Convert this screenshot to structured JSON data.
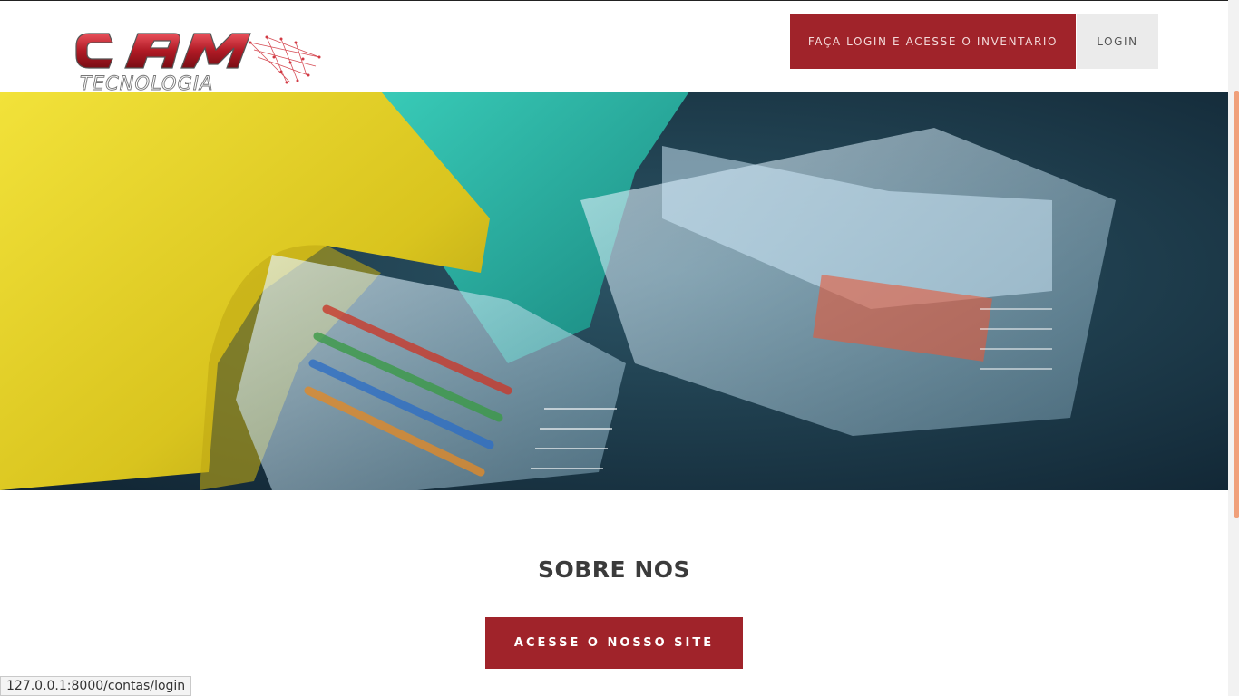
{
  "brand": {
    "logo_main": "CAM",
    "logo_sub": "TECNOLOGIA"
  },
  "nav": {
    "inventory_login_label": "FAÇA LOGIN E ACESSE O INVENTARIO",
    "login_label": "LOGIN"
  },
  "hero": {
    "image_name": "ethernet-cables-image"
  },
  "about": {
    "title": "SOBRE NOS",
    "cta_label": "ACESSE O NOSSO SITE"
  },
  "status_bar": {
    "url": "127.0.0.1:8000/contas/login"
  },
  "colors": {
    "accent": "#a0232a",
    "secondary_button": "#ebebeb",
    "scroll_thumb": "#f0a07a"
  }
}
